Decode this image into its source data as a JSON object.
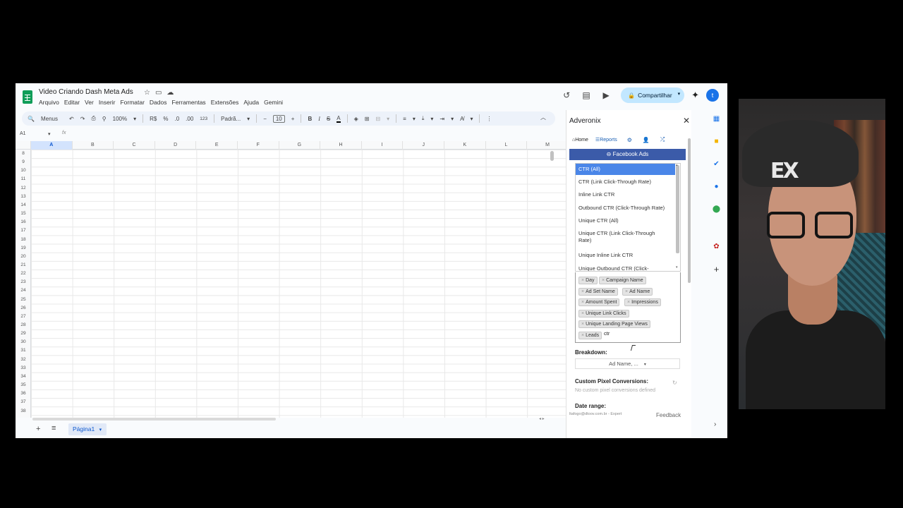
{
  "doc": {
    "title": "Video Criando Dash Meta Ads",
    "menus": [
      "Arquivo",
      "Editar",
      "Ver",
      "Inserir",
      "Formatar",
      "Dados",
      "Ferramentas",
      "Extensões",
      "Ajuda",
      "Gemini"
    ],
    "share_label": "Compartilhar",
    "avatar_letter": "t"
  },
  "toolbar": {
    "search": "Menus",
    "zoom": "100%",
    "currency": "R$",
    "percent": "%",
    "dec_less": ".0",
    "dec_more": ".00",
    "number_format": "123",
    "font": "Padrã...",
    "font_size": "10",
    "bold": "B",
    "italic": "I"
  },
  "formula_bar": {
    "name_box": "A1",
    "fx": "fx"
  },
  "grid": {
    "columns": [
      "A",
      "B",
      "C",
      "D",
      "E",
      "F",
      "G",
      "H",
      "I",
      "J",
      "K",
      "L",
      "M"
    ],
    "rows": [
      "8",
      "9",
      "10",
      "11",
      "12",
      "13",
      "14",
      "15",
      "16",
      "17",
      "18",
      "19",
      "20",
      "21",
      "22",
      "23",
      "24",
      "25",
      "26",
      "27",
      "28",
      "29",
      "30",
      "31",
      "32",
      "33",
      "34",
      "35",
      "36",
      "37",
      "38"
    ]
  },
  "sheets": {
    "active": "Página1"
  },
  "sidebar": {
    "title": "Adveronix",
    "nav": {
      "home": "Home",
      "reports": "Reports"
    },
    "connector": "Facebook Ads",
    "dropdown_options": [
      "CTR (All)",
      "CTR (Link Click-Through Rate)",
      "Inline Link CTR",
      "Outbound CTR (Click-Through Rate)",
      "Unique CTR (All)",
      "Unique CTR (Link Click-Through Rate)",
      "Unique Inline Link CTR",
      "Unique Outbound CTR (Click-"
    ],
    "tags": [
      "Day",
      "Campaign Name",
      "Ad Set Name",
      "Ad Name",
      "Amount Spent",
      "Impressions",
      "Unique Link Clicks",
      "Unique Landing Page Views",
      "Leads"
    ],
    "search_text": "ctr",
    "breakdown_label": "Breakdown:",
    "breakdown_value": "Ad Name, ...",
    "pixel_label": "Custom Pixel Conversions:",
    "pixel_empty": "No custom pixel conversions defined",
    "date_label": "Date range:",
    "footer_email": "ltafogo@dtoov.com.br - Expert",
    "feedback": "Feedback"
  },
  "webcam": {
    "cap_logo": "EX"
  }
}
